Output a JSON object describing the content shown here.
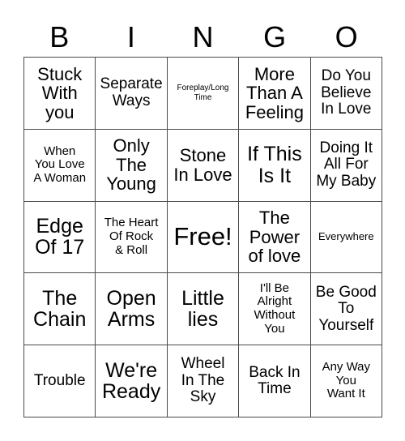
{
  "card": {
    "header_letters": [
      "B",
      "I",
      "N",
      "G",
      "O"
    ],
    "rows": [
      [
        {
          "text": "Stuck\nWith\nyou",
          "size": "lg"
        },
        {
          "text": "Separate\nWays",
          "size": "md"
        },
        {
          "text": "Foreplay/Long\nTime",
          "size": "xxs"
        },
        {
          "text": "More\nThan A\nFeeling",
          "size": "lg"
        },
        {
          "text": "Do You\nBelieve\nIn Love",
          "size": "md"
        }
      ],
      [
        {
          "text": "When\nYou Love\nA Woman",
          "size": "sm"
        },
        {
          "text": "Only\nThe\nYoung",
          "size": "lg"
        },
        {
          "text": "Stone\nIn Love",
          "size": "lg"
        },
        {
          "text": "If This\nIs It",
          "size": "xl"
        },
        {
          "text": "Doing It\nAll For\nMy Baby",
          "size": "md"
        }
      ],
      [
        {
          "text": "Edge\nOf 17",
          "size": "xl"
        },
        {
          "text": "The Heart\nOf Rock\n& Roll",
          "size": "sm"
        },
        {
          "text": "Free!",
          "size": "xxl"
        },
        {
          "text": "The\nPower\nof love",
          "size": "lg"
        },
        {
          "text": "Everywhere",
          "size": "xs"
        }
      ],
      [
        {
          "text": "The\nChain",
          "size": "xl"
        },
        {
          "text": "Open\nArms",
          "size": "xl"
        },
        {
          "text": "Little\nlies",
          "size": "xl"
        },
        {
          "text": "I'll Be\nAlright\nWithout\nYou",
          "size": "sm"
        },
        {
          "text": "Be Good\nTo\nYourself",
          "size": "md"
        }
      ],
      [
        {
          "text": "Trouble",
          "size": "md"
        },
        {
          "text": "We're\nReady",
          "size": "xl"
        },
        {
          "text": "Wheel\nIn The\nSky",
          "size": "md"
        },
        {
          "text": "Back In\nTime",
          "size": "md"
        },
        {
          "text": "Any Way\nYou\nWant It",
          "size": "sm"
        }
      ]
    ]
  },
  "colors": {
    "background": "#ffffff",
    "grid_line": "#4a4a4a",
    "text": "#000000"
  }
}
